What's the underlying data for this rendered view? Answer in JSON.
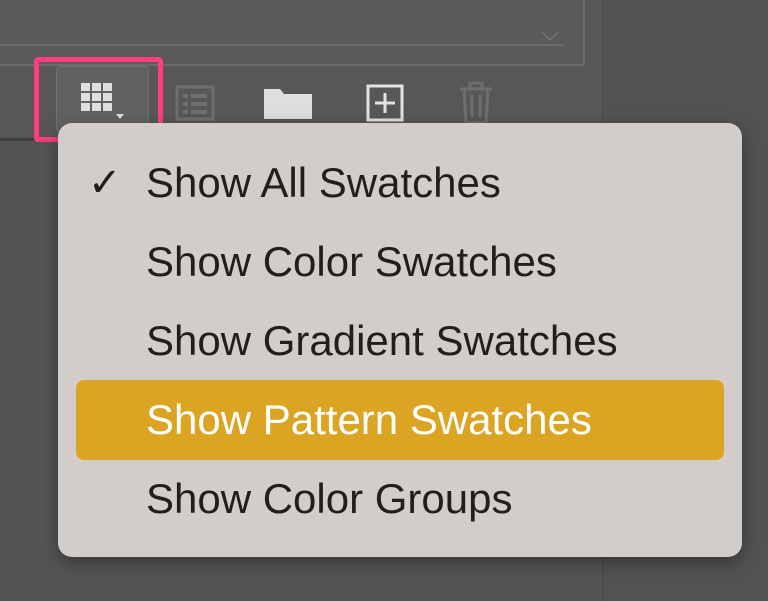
{
  "menu": {
    "items": [
      {
        "label": "Show All Swatches",
        "checked": true,
        "check_glyph": "✓",
        "highlighted": false
      },
      {
        "label": "Show Color Swatches",
        "checked": false,
        "highlighted": false
      },
      {
        "label": "Show Gradient Swatches",
        "checked": false,
        "highlighted": false
      },
      {
        "label": "Show Pattern Swatches",
        "checked": false,
        "highlighted": true
      },
      {
        "label": "Show Color Groups",
        "checked": false,
        "highlighted": false
      }
    ],
    "highlight_color": "#dba422",
    "background_color": "#d2cdc8"
  },
  "toolbar": {
    "buttons": [
      {
        "icon": "swatch-grid-menu-icon"
      },
      {
        "icon": "swatch-library-icon"
      },
      {
        "icon": "folder-icon"
      },
      {
        "icon": "new-swatch-icon"
      },
      {
        "icon": "trash-icon"
      }
    ],
    "annotation_color": "#ff3d7f"
  },
  "colors": {
    "panel_background": "#575757",
    "menu_text": "#1f1f1f",
    "highlight_text": "#ffffff"
  }
}
